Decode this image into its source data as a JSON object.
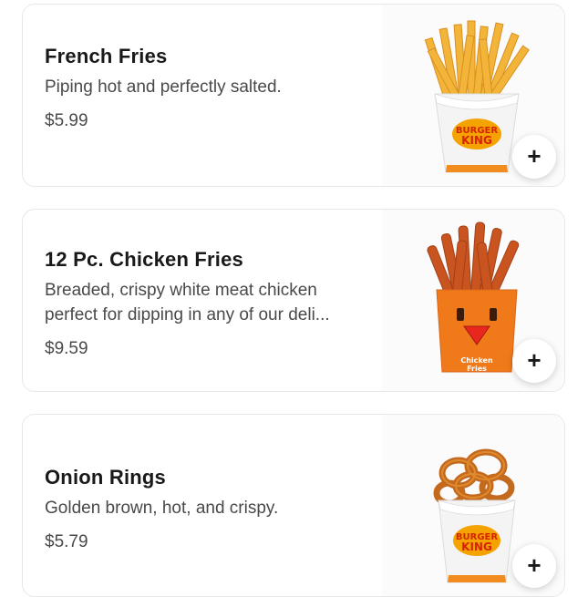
{
  "items": [
    {
      "title": "French Fries",
      "description": "Piping hot and perfectly salted.",
      "price": "$5.99",
      "add_label": "+",
      "image_icon": "french-fries-photo",
      "brand_text": [
        "BURGER",
        "KING"
      ]
    },
    {
      "title": "12 Pc. Chicken Fries",
      "description": "Breaded, crispy white meat chicken perfect for dipping in any of our deli...",
      "price": "$9.59",
      "add_label": "+",
      "image_icon": "chicken-fries-photo",
      "box_text": [
        "Chicken",
        "Fries"
      ]
    },
    {
      "title": "Onion Rings",
      "description": "Golden brown, hot, and crispy.",
      "price": "$5.79",
      "add_label": "+",
      "image_icon": "onion-rings-photo",
      "brand_text": [
        "BURGER",
        "KING"
      ]
    }
  ],
  "colors": {
    "bk_red": "#d62300",
    "bk_orange": "#f5a300",
    "chicken_box": "#f07a1a",
    "fries_yellow": "#f2b53a"
  }
}
